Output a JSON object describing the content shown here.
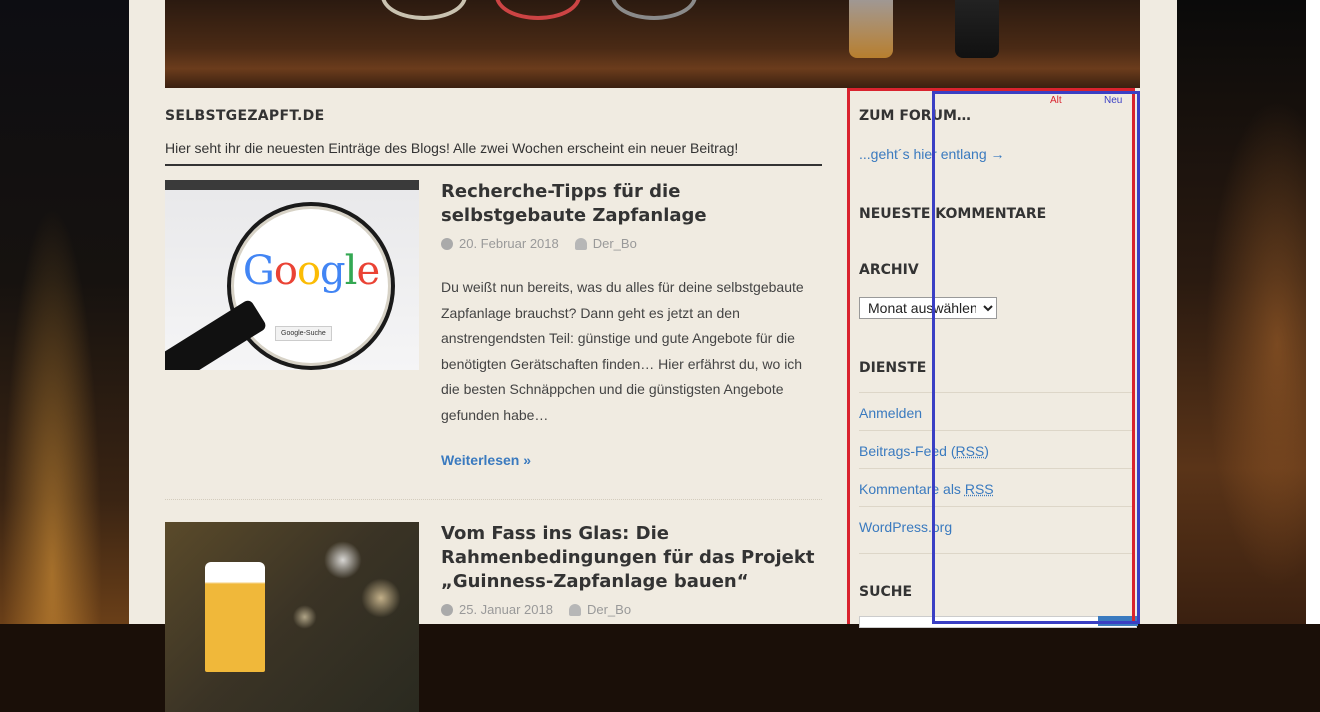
{
  "site": {
    "title": "SELBSTGEZAPFT.DE",
    "description": "Hier seht ihr die neuesten Einträge des Blogs! Alle zwei Wochen erscheint ein neuer Beitrag!"
  },
  "posts": [
    {
      "title": "Recherche-Tipps für die selbstgebaute Zapfanlage",
      "date": "20. Februar 2018",
      "author": "Der_Bo",
      "excerpt": "Du weißt nun bereits, was du alles für deine selbstgebaute Zapfanlage brauchst? Dann geht es jetzt an den anstrengendsten Teil: günstige und gute Angebote für die benötigten Gerätschaften finden… Hier erfährst du, wo ich die besten Schnäppchen und die günstigsten Angebote gefunden habe…",
      "more": "Weiterlesen »",
      "thumb": {
        "google_text": "Google",
        "search_button": "Google-Suche"
      }
    },
    {
      "title": "Vom Fass ins Glas: Die Rahmenbedingungen für das Projekt „Guinness-Zapfanlage bauen“",
      "date": "25. Januar 2018",
      "author": "Der_Bo"
    }
  ],
  "sidebar": {
    "forum_title": "ZUM FORUM…",
    "forum_link": "...geht´s hier entlang →",
    "comments_title": "NEUESTE KOMMENTARE",
    "archive_title": "ARCHIV",
    "archive_select": "Monat auswählen",
    "services_title": "DIENSTE",
    "services": {
      "login": "Anmelden",
      "feed_prefix": "Beitrags-Feed (",
      "feed_abbr": "RSS",
      "feed_suffix": ")",
      "comments_prefix": "Kommentare als ",
      "comments_abbr": "RSS",
      "wordpress": "WordPress.org"
    },
    "search_title": "SUCHE"
  },
  "overlay": {
    "alt_label": "Alt",
    "neu_label": "Neu",
    "alt_color": "#d9232e",
    "neu_color": "#3a3fc4"
  },
  "colors": {
    "link": "#3a7abf",
    "page_bg": "#f0ebe1"
  }
}
